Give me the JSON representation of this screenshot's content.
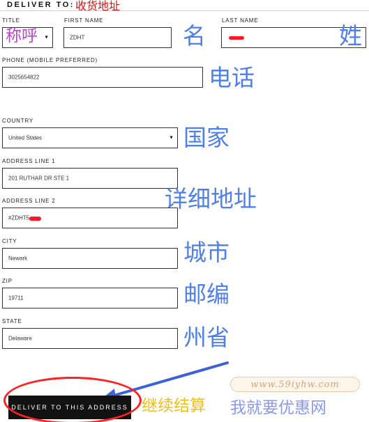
{
  "header": {
    "title": "DELIVER TO:",
    "annotation": "收货地址"
  },
  "form": {
    "title_field": {
      "label": "TITLE",
      "annotation": "称呼"
    },
    "first_name": {
      "label": "FIRST NAME",
      "value": "ZDHT",
      "annotation": "名"
    },
    "last_name": {
      "label": "LAST NAME",
      "value": "",
      "annotation": "姓"
    },
    "phone": {
      "label": "PHONE (MOBILE PREFERRED)",
      "value": "3025654822",
      "annotation": "电话"
    },
    "country": {
      "label": "COUNTRY",
      "value": "United States",
      "annotation": "国家"
    },
    "address1": {
      "label": "ADDRESS LINE 1",
      "value": "201 RUTHAR DR  STE 1"
    },
    "address_annotation": "详细地址",
    "address2": {
      "label": "ADDRESS LINE 2",
      "value": "#ZDHT5"
    },
    "city": {
      "label": "CITY",
      "value": "Newark",
      "annotation": "城市"
    },
    "zip": {
      "label": "ZIP",
      "value": "19711",
      "annotation": "邮编"
    },
    "state": {
      "label": "STATE",
      "value": "Delaware",
      "annotation": "州省"
    }
  },
  "submit": {
    "label": "DELIVER TO THIS ADDRESS",
    "annotation": "继续结算"
  },
  "watermark": {
    "url": "www.59iyhw.com",
    "brand": "我就要优惠网"
  },
  "colors": {
    "annotation_blue": "#4f80e8",
    "annotation_purple": "#c23fd6",
    "annotation_red": "#e01010",
    "annotation_yellow": "#f2c012",
    "button_bg": "#121212",
    "circle_red": "#ff2020"
  }
}
